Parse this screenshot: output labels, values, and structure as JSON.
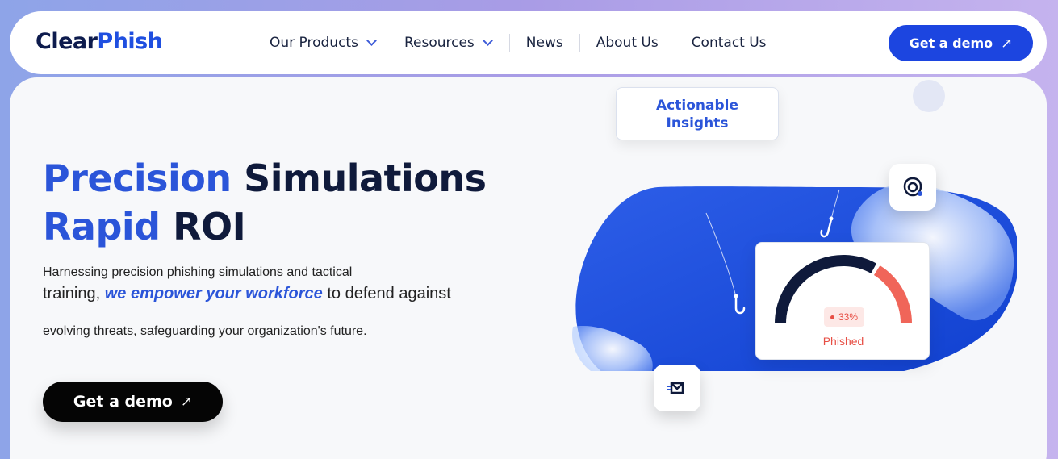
{
  "brand": {
    "part1": "Clear",
    "part2": "Phish"
  },
  "nav": {
    "items": [
      {
        "label": "Our Products"
      },
      {
        "label": "Resources"
      },
      {
        "label": "News"
      },
      {
        "label": "About Us"
      },
      {
        "label": "Contact Us"
      }
    ],
    "cta_label": "Get a demo",
    "cta_arrow": "↗"
  },
  "hero": {
    "title_accent_1": "Precision",
    "title_rest_1": "Simulations",
    "title_accent_2": "Rapid",
    "title_rest_2": "ROI",
    "desc_line1": "Harnessing precision phishing simulations and tactical",
    "desc_line2_pre": "training, ",
    "desc_line2_em": "we empower your workforce",
    "desc_line2_post": " to defend against",
    "desc_line3": "evolving threats, safeguarding your organization's future.",
    "cta_label": "Get a demo",
    "cta_arrow": "↗"
  },
  "illustration": {
    "insight_line1": "Actionable",
    "insight_line2": "Insights",
    "gauge_percent": "33%",
    "gauge_value": 0.33,
    "gauge_label": "Phished"
  },
  "colors": {
    "brand_blue": "#1c45e0",
    "accent_blue": "#2b55d9",
    "navy": "#0f1a3b",
    "alert_red": "#e74f45"
  }
}
